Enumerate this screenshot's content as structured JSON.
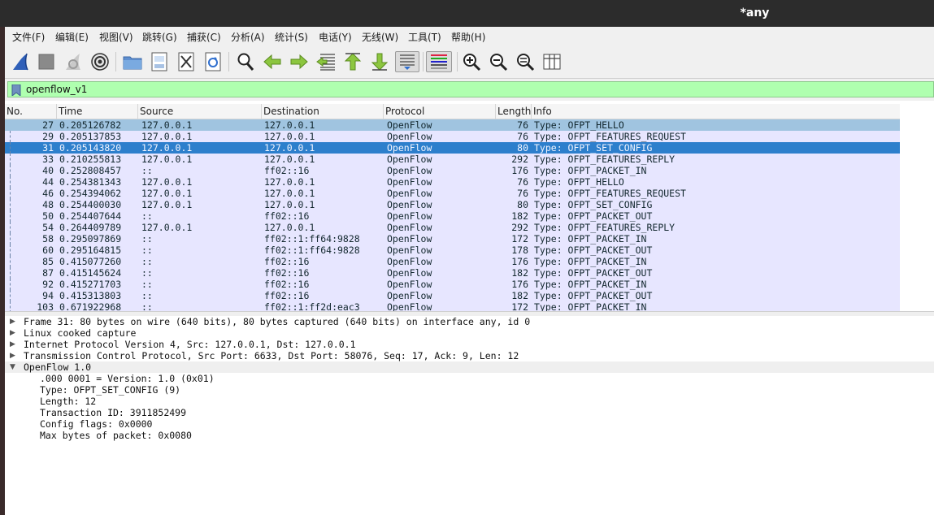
{
  "window": {
    "title": "*any"
  },
  "menu": [
    "文件(F)",
    "编辑(E)",
    "视图(V)",
    "跳转(G)",
    "捕获(C)",
    "分析(A)",
    "统计(S)",
    "电话(Y)",
    "无线(W)",
    "工具(T)",
    "帮助(H)"
  ],
  "toolbar": {
    "icons": [
      "shark-fin-start-icon",
      "stop-square-icon",
      "restart-shark-icon",
      "capture-options-gear-icon",
      "open-folder-icon",
      "save-file-icon",
      "close-file-icon",
      "reload-icon",
      "find-magnifier-icon",
      "back-arrow-icon",
      "forward-arrow-icon",
      "goto-packet-icon",
      "first-packet-icon",
      "last-packet-icon",
      "autoscroll-icon",
      "colorize-icon",
      "zoom-in-icon",
      "zoom-out-icon",
      "zoom-normal-icon",
      "resize-columns-icon"
    ]
  },
  "filter": {
    "value": "openflow_v1",
    "bg": "#afffaf"
  },
  "columns": [
    "No.",
    "Time",
    "Source",
    "Destination",
    "Protocol",
    "Length",
    "Info"
  ],
  "packets": [
    {
      "no": "27",
      "time": "0.205126782",
      "src": "127.0.0.1",
      "dst": "127.0.0.1",
      "proto": "OpenFlow",
      "len": "76",
      "info": "Type: OFPT_HELLO"
    },
    {
      "no": "29",
      "time": "0.205137853",
      "src": "127.0.0.1",
      "dst": "127.0.0.1",
      "proto": "OpenFlow",
      "len": "76",
      "info": "Type: OFPT_FEATURES_REQUEST"
    },
    {
      "no": "31",
      "time": "0.205143820",
      "src": "127.0.0.1",
      "dst": "127.0.0.1",
      "proto": "OpenFlow",
      "len": "80",
      "info": "Type: OFPT_SET_CONFIG"
    },
    {
      "no": "33",
      "time": "0.210255813",
      "src": "127.0.0.1",
      "dst": "127.0.0.1",
      "proto": "OpenFlow",
      "len": "292",
      "info": "Type: OFPT_FEATURES_REPLY"
    },
    {
      "no": "40",
      "time": "0.252808457",
      "src": "::",
      "dst": "ff02::16",
      "proto": "OpenFlow",
      "len": "176",
      "info": "Type: OFPT_PACKET_IN"
    },
    {
      "no": "44",
      "time": "0.254381343",
      "src": "127.0.0.1",
      "dst": "127.0.0.1",
      "proto": "OpenFlow",
      "len": "76",
      "info": "Type: OFPT_HELLO"
    },
    {
      "no": "46",
      "time": "0.254394062",
      "src": "127.0.0.1",
      "dst": "127.0.0.1",
      "proto": "OpenFlow",
      "len": "76",
      "info": "Type: OFPT_FEATURES_REQUEST"
    },
    {
      "no": "48",
      "time": "0.254400030",
      "src": "127.0.0.1",
      "dst": "127.0.0.1",
      "proto": "OpenFlow",
      "len": "80",
      "info": "Type: OFPT_SET_CONFIG"
    },
    {
      "no": "50",
      "time": "0.254407644",
      "src": "::",
      "dst": "ff02::16",
      "proto": "OpenFlow",
      "len": "182",
      "info": "Type: OFPT_PACKET_OUT"
    },
    {
      "no": "54",
      "time": "0.264409789",
      "src": "127.0.0.1",
      "dst": "127.0.0.1",
      "proto": "OpenFlow",
      "len": "292",
      "info": "Type: OFPT_FEATURES_REPLY"
    },
    {
      "no": "58",
      "time": "0.295097869",
      "src": "::",
      "dst": "ff02::1:ff64:9828",
      "proto": "OpenFlow",
      "len": "172",
      "info": "Type: OFPT_PACKET_IN"
    },
    {
      "no": "60",
      "time": "0.295164815",
      "src": "::",
      "dst": "ff02::1:ff64:9828",
      "proto": "OpenFlow",
      "len": "178",
      "info": "Type: OFPT_PACKET_OUT"
    },
    {
      "no": "85",
      "time": "0.415077260",
      "src": "::",
      "dst": "ff02::16",
      "proto": "OpenFlow",
      "len": "176",
      "info": "Type: OFPT_PACKET_IN"
    },
    {
      "no": "87",
      "time": "0.415145624",
      "src": "::",
      "dst": "ff02::16",
      "proto": "OpenFlow",
      "len": "182",
      "info": "Type: OFPT_PACKET_OUT"
    },
    {
      "no": "92",
      "time": "0.415271703",
      "src": "::",
      "dst": "ff02::16",
      "proto": "OpenFlow",
      "len": "176",
      "info": "Type: OFPT_PACKET_IN"
    },
    {
      "no": "94",
      "time": "0.415313803",
      "src": "::",
      "dst": "ff02::16",
      "proto": "OpenFlow",
      "len": "182",
      "info": "Type: OFPT_PACKET_OUT"
    },
    {
      "no": "103",
      "time": "0.671922968",
      "src": "::",
      "dst": "ff02::1:ff2d:eac3",
      "proto": "OpenFlow",
      "len": "172",
      "info": "Type: OFPT_PACKET_IN"
    }
  ],
  "selected_no": "31",
  "related_no": "27",
  "colors": {
    "selected": "#2d7fcc",
    "related": "#a0c4e0",
    "row": "#e7e6ff",
    "titlebar": "#2c2c2c"
  },
  "details": {
    "frame": "Frame 31: 80 bytes on wire (640 bits), 80 bytes captured (640 bits) on interface any, id 0",
    "linux": "Linux cooked capture",
    "ip": "Internet Protocol Version 4, Src: 127.0.0.1, Dst: 127.0.0.1",
    "tcp": "Transmission Control Protocol, Src Port: 6633, Dst Port: 58076, Seq: 17, Ack: 9, Len: 12",
    "openflow": "OpenFlow 1.0",
    "fields": [
      ".000 0001 = Version: 1.0 (0x01)",
      "Type: OFPT_SET_CONFIG (9)",
      "Length: 12",
      "Transaction ID: 3911852499",
      "Config flags: 0x0000",
      "Max bytes of packet: 0x0080"
    ]
  }
}
